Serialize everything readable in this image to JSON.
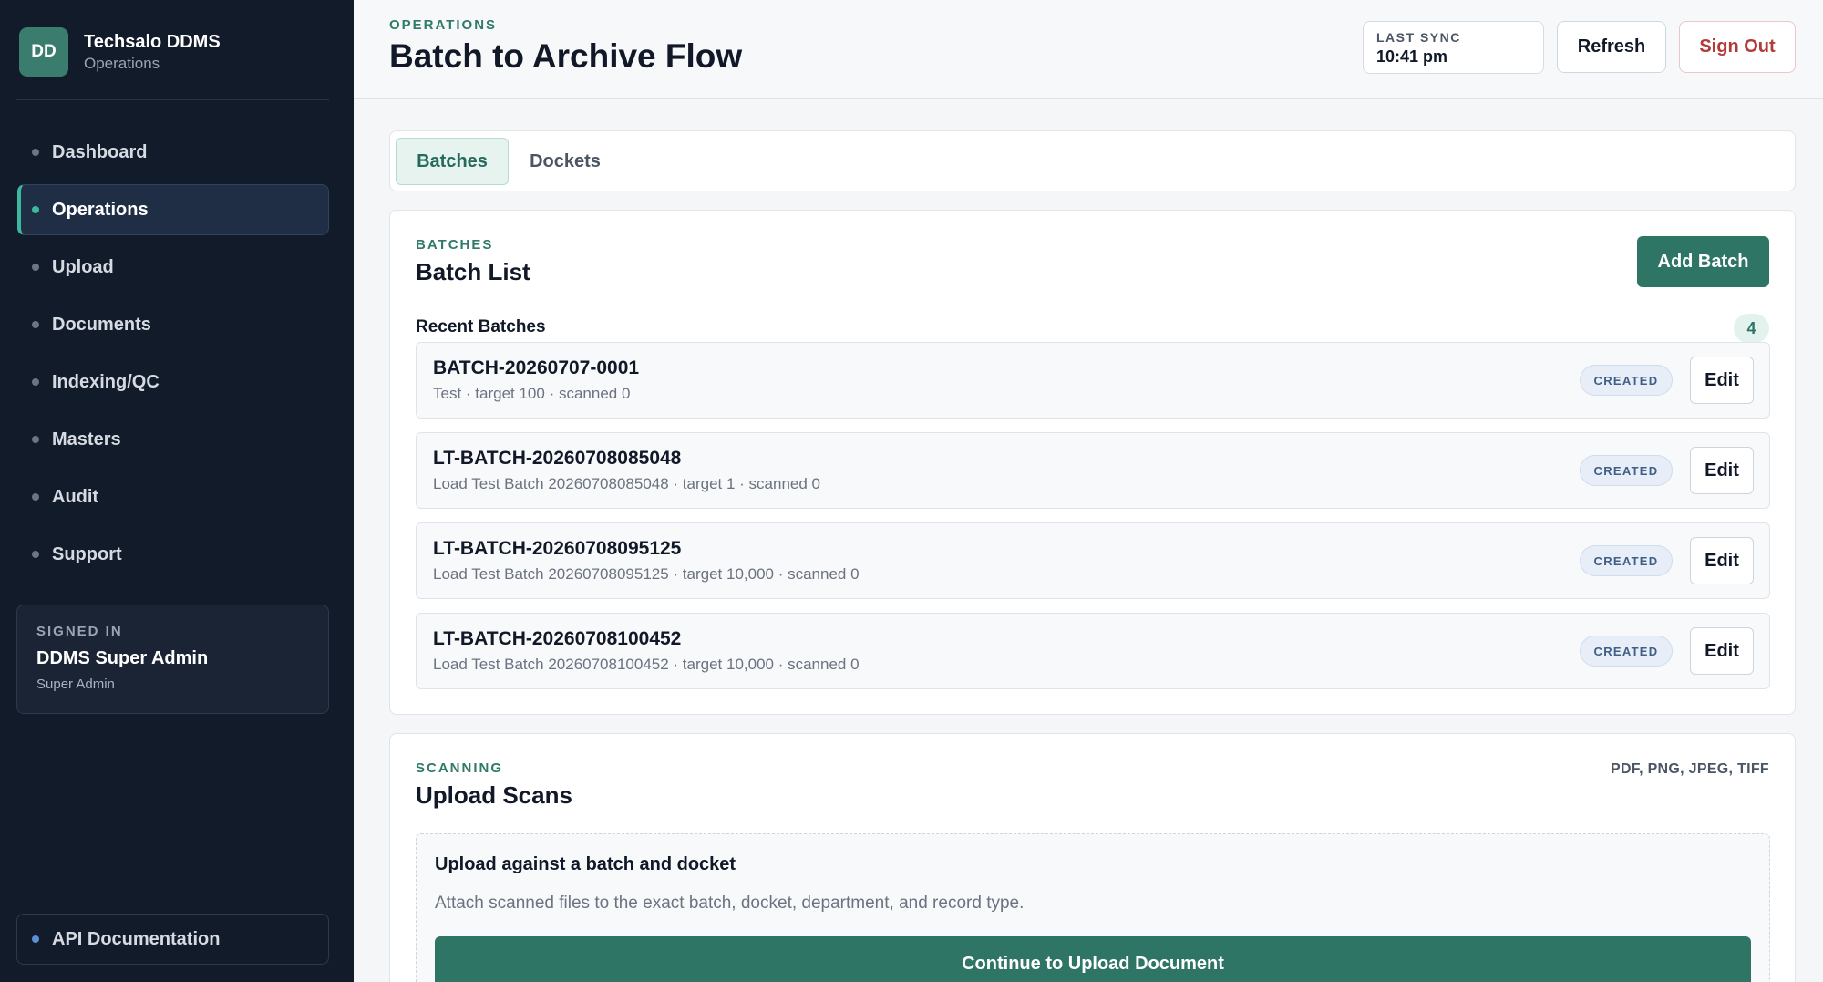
{
  "sidebar": {
    "brand": {
      "logo_initials": "DD",
      "name": "Techsalo DDMS",
      "subtitle": "Operations"
    },
    "nav_items": [
      {
        "label": "Dashboard",
        "active": false
      },
      {
        "label": "Operations",
        "active": true
      },
      {
        "label": "Upload",
        "active": false
      },
      {
        "label": "Documents",
        "active": false
      },
      {
        "label": "Indexing/QC",
        "active": false
      },
      {
        "label": "Masters",
        "active": false
      },
      {
        "label": "Audit",
        "active": false
      },
      {
        "label": "Support",
        "active": false
      }
    ],
    "signed_in": {
      "label": "SIGNED IN",
      "name": "DDMS Super Admin",
      "role": "Super Admin"
    },
    "api_link": {
      "label": "API Documentation"
    }
  },
  "header": {
    "eyebrow": "OPERATIONS",
    "title": "Batch to Archive Flow",
    "last_sync": {
      "label": "LAST SYNC",
      "time": "10:41 pm"
    },
    "refresh_label": "Refresh",
    "sign_out_label": "Sign Out"
  },
  "tabs": [
    {
      "label": "Batches",
      "active": true
    },
    {
      "label": "Dockets",
      "active": false
    }
  ],
  "batches": {
    "eyebrow": "BATCHES",
    "title": "Batch List",
    "add_label": "Add Batch",
    "recent_label": "Recent Batches",
    "count": "4",
    "edit_label": "Edit",
    "rows": [
      {
        "id": "BATCH-20260707-0001",
        "meta": "Test · target 100 · scanned 0",
        "status": "CREATED"
      },
      {
        "id": "LT-BATCH-20260708085048",
        "meta": "Load Test Batch 20260708085048 · target 1 · scanned 0",
        "status": "CREATED"
      },
      {
        "id": "LT-BATCH-20260708095125",
        "meta": "Load Test Batch 20260708095125 · target 10,000 · scanned 0",
        "status": "CREATED"
      },
      {
        "id": "LT-BATCH-20260708100452",
        "meta": "Load Test Batch 20260708100452 · target 10,000 · scanned 0",
        "status": "CREATED"
      }
    ]
  },
  "scanning": {
    "eyebrow": "SCANNING",
    "title": "Upload Scans",
    "formats": "PDF, PNG, JPEG, TIFF",
    "upload_title": "Upload against a batch and docket",
    "upload_desc": "Attach scanned files to the exact batch, docket, department, and record type.",
    "continue_label": "Continue to Upload Document"
  },
  "colors": {
    "sidebar_bg": "#121b29",
    "accent": "#2f7565",
    "accent_light": "#3cb8a1",
    "danger": "#b23a3a",
    "status_badge": "#3f5f86"
  }
}
